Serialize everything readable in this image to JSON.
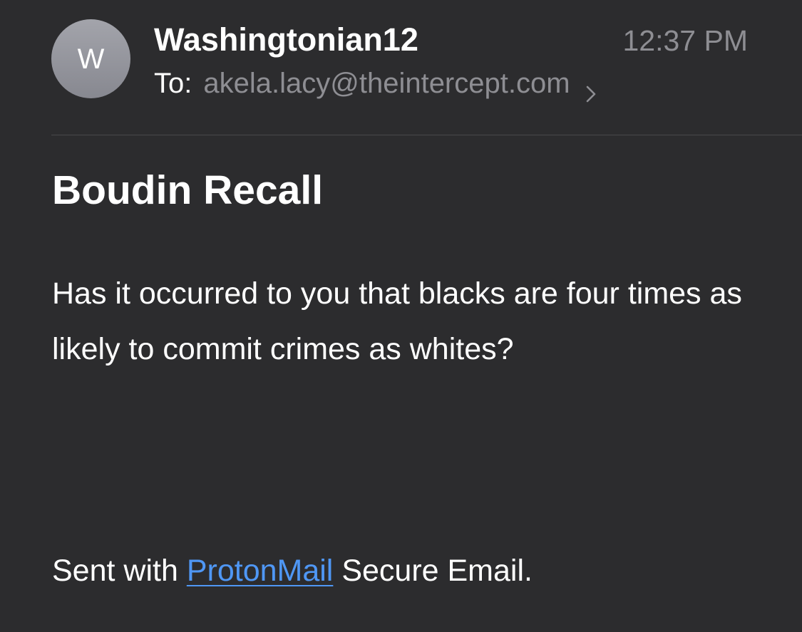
{
  "header": {
    "avatar_initial": "W",
    "sender": "Washingtonian12",
    "time": "12:37 PM",
    "to_label": "To:",
    "to_address": "akela.lacy@theintercept.com",
    "chevron_icon": "chevron-right-icon"
  },
  "message": {
    "subject": "Boudin Recall",
    "body": "Has it occurred to you that blacks are four times as likely to commit crimes as whites?",
    "signature_prefix": "Sent with",
    "signature_link": "ProtonMail",
    "signature_suffix": "Secure Email."
  },
  "colors": {
    "background": "#2c2c2e",
    "primary_text": "#ffffff",
    "secondary_text": "#8e8e93",
    "link": "#4f97f5",
    "avatar": "#9a9ba2",
    "divider": "#48484a"
  }
}
